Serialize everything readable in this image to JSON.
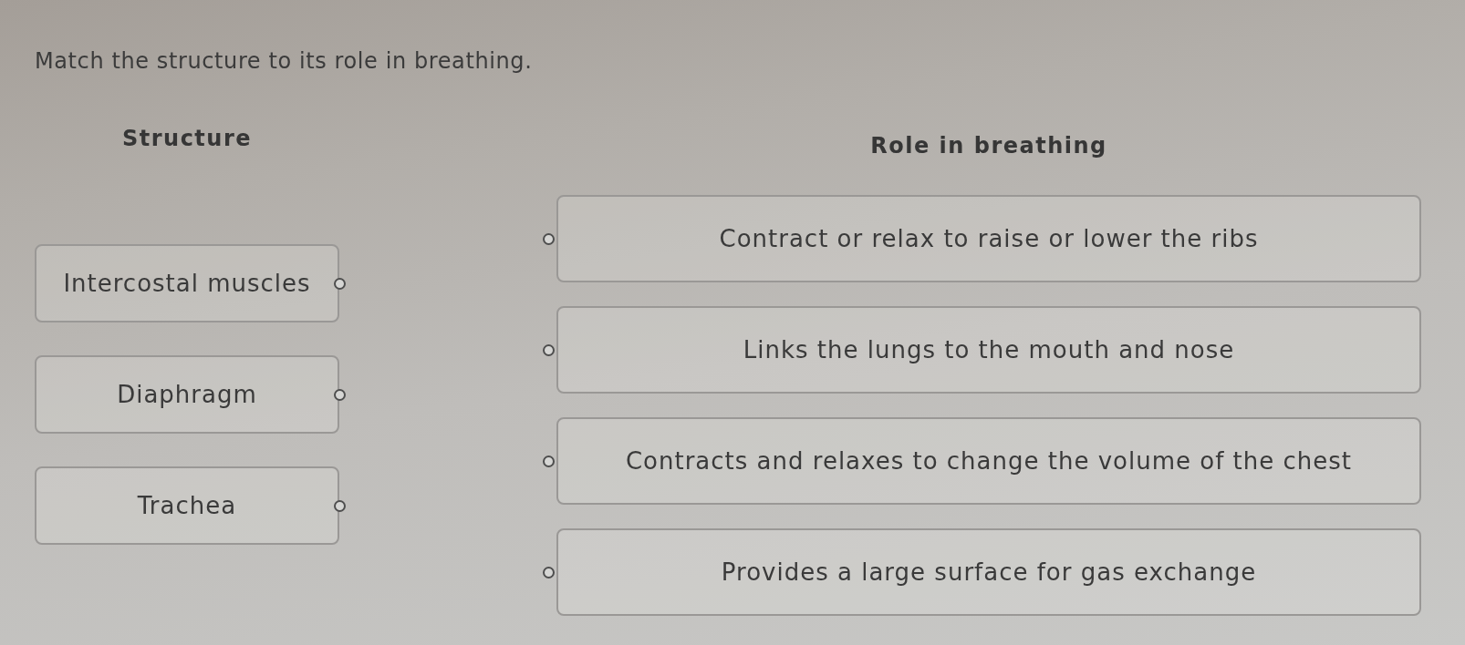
{
  "title": "Match the structure to its role in breathing.",
  "structure_column": {
    "heading": "Structure",
    "items": [
      "Intercostal muscles",
      "Diaphragm",
      "Trachea"
    ]
  },
  "role_column": {
    "heading": "Role in breathing",
    "items": [
      "Contract or relax to raise or lower the ribs",
      "Links the lungs to the mouth and nose",
      "Contracts and relaxes to change the volume of the chest",
      "Provides a large surface for gas exchange"
    ]
  }
}
